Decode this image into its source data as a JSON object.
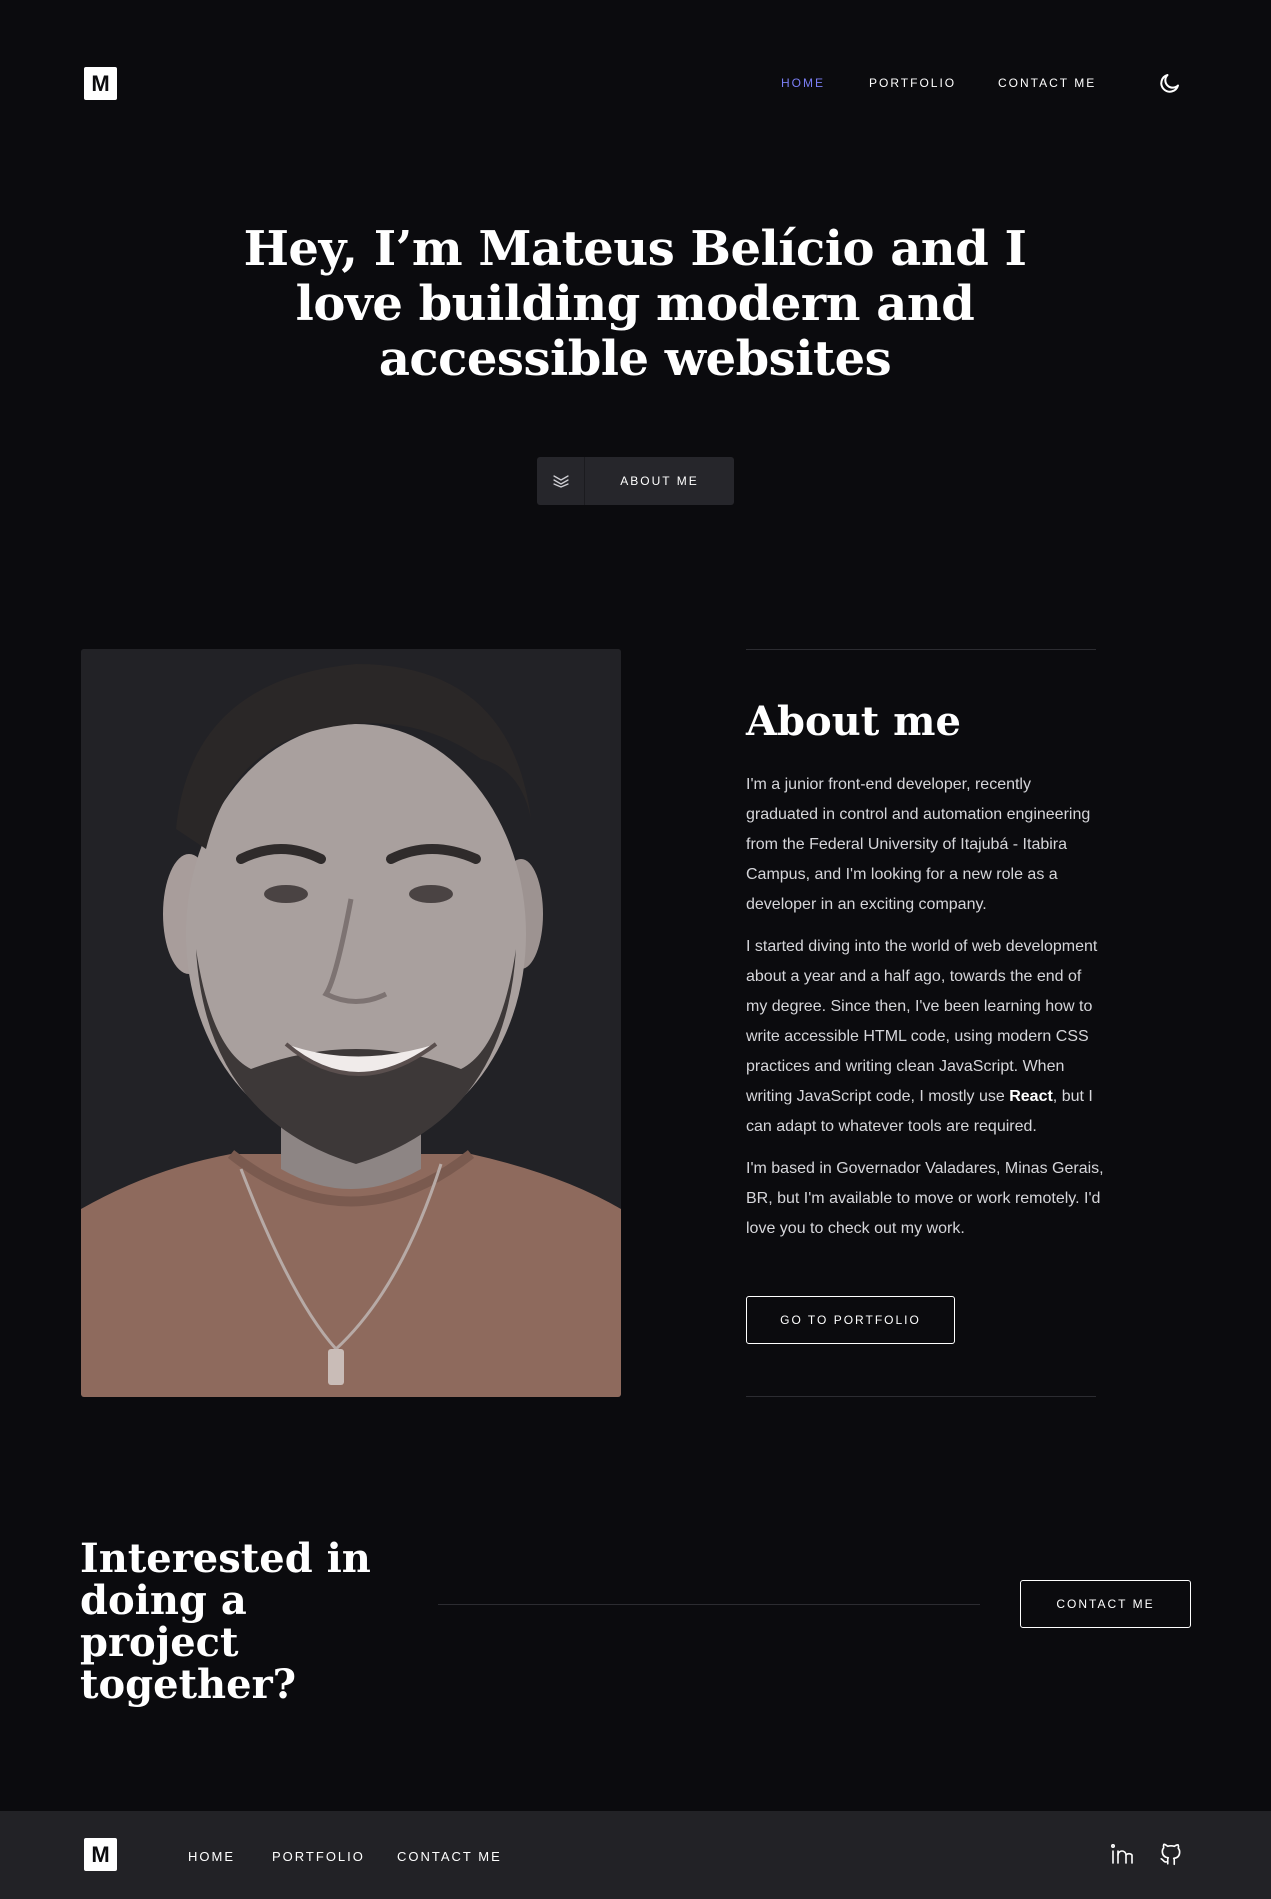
{
  "header": {
    "logo": "M",
    "nav": [
      {
        "label": "HOME",
        "active": true
      },
      {
        "label": "PORTFOLIO",
        "active": false
      },
      {
        "label": "CONTACT ME",
        "active": false
      }
    ],
    "theme_icon": "moon-icon"
  },
  "hero": {
    "title": "Hey, I’m Mateus Belício and I love building modern and accessible websites",
    "button_label": "ABOUT ME",
    "button_icon": "double-chevron-down-icon"
  },
  "about": {
    "title": "About me",
    "paragraphs": [
      "I'm a junior front-end developer, recently graduated in control and automation engineering from the Federal University of Itajubá - Itabira Campus, and I'm looking for a new role as a developer in an exciting company.",
      "I started diving into the world of web development about a year and a half ago, towards the end of my degree. Since then, I've been learning how to write accessible HTML code, using modern CSS practices and writing clean JavaScript. When writing JavaScript code, I mostly use ",
      "React",
      ", but I can adapt to whatever tools are required.",
      "I'm based in Governador Valadares, Minas Gerais, BR, but I'm available to move or work remotely. I'd love you to check out my work."
    ],
    "button_label": "GO TO PORTFOLIO"
  },
  "cta": {
    "title": "Interested in doing a project together?",
    "button_label": "CONTACT ME"
  },
  "footer": {
    "logo": "M",
    "nav": [
      "HOME",
      "PORTFOLIO",
      "CONTACT ME"
    ],
    "social": [
      "linkedin-icon",
      "github-icon"
    ]
  },
  "colors": {
    "background": "#0b0b0e",
    "accent": "#7b7ff5",
    "panel": "#222226"
  }
}
